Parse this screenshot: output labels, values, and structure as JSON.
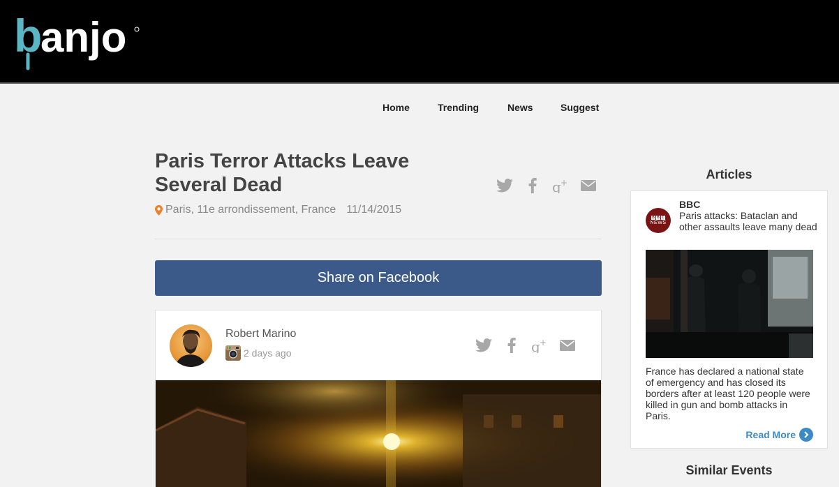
{
  "brand": {
    "logo_text": "banjo",
    "accent_color": "#5bb6c4"
  },
  "nav": [
    {
      "label": "Home"
    },
    {
      "label": "Trending"
    },
    {
      "label": "News"
    },
    {
      "label": "Suggest"
    }
  ],
  "event": {
    "title_line1": "Paris Terror Attacks Leave",
    "title_line2": "Several Dead",
    "location": "Paris, 11e arrondissement, France",
    "date": "11/14/2015",
    "pin_color": "#e8832a"
  },
  "share_icons": [
    "twitter-icon",
    "facebook-icon",
    "google-plus-icon",
    "email-icon"
  ],
  "facebook_share": {
    "label": "Share on Facebook",
    "color": "#3b5a89"
  },
  "post": {
    "author": "Robert Marino",
    "time": "2 days ago",
    "source_icon": "instagram-icon"
  },
  "sidebar": {
    "articles_heading": "Articles",
    "article": {
      "source": "BBC",
      "logo_blocks": [
        "B",
        "B",
        "C"
      ],
      "logo_subtext": "NEWS",
      "headline": "Paris attacks: Bataclan and other assaults leave many dead",
      "summary": "France has declared a national state of emergency and has closed its borders after at least 120 people were killed in gun and bomb attacks in Paris.",
      "read_more": "Read More"
    },
    "similar_heading": "Similar Events",
    "link_color": "#3e8ac4"
  }
}
